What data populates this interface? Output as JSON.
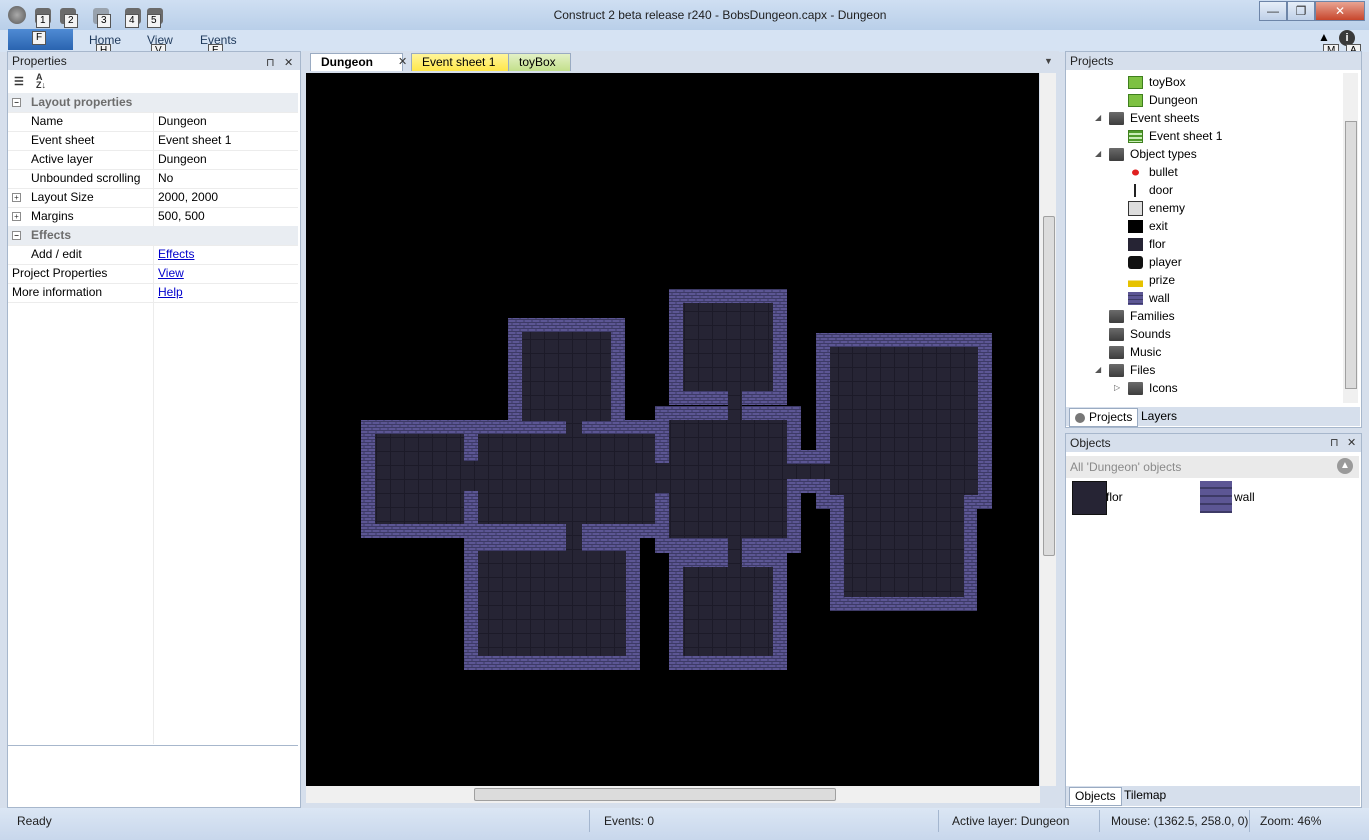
{
  "window": {
    "title": "Construct 2 beta release r240 - BobsDungeon.capx - Dungeon",
    "controls": [
      "—",
      "❐",
      "✕"
    ]
  },
  "qat": {
    "keytips": [
      "1",
      "2",
      "3",
      "4",
      "5"
    ]
  },
  "ribbon": {
    "file_keytip": "F",
    "tabs": [
      {
        "label": "Home",
        "keytip": "H"
      },
      {
        "label": "View",
        "keytip": "V"
      },
      {
        "label": "Events",
        "keytip": "E"
      }
    ],
    "right_keytips": [
      "M",
      "A"
    ]
  },
  "properties": {
    "title": "Properties",
    "pin": "⊓",
    "close": "✕",
    "rows": [
      {
        "type": "cat",
        "key": "Layout properties",
        "value": "",
        "expander": "−"
      },
      {
        "type": "prop",
        "key": "Name",
        "value": "Dungeon"
      },
      {
        "type": "prop",
        "key": "Event sheet",
        "value": "Event sheet 1"
      },
      {
        "type": "prop",
        "key": "Active layer",
        "value": "Dungeon"
      },
      {
        "type": "prop",
        "key": "Unbounded scrolling",
        "value": "No"
      },
      {
        "type": "prop",
        "key": "Layout Size",
        "value": "2000, 2000",
        "expander": "+"
      },
      {
        "type": "prop",
        "key": "Margins",
        "value": "500, 500",
        "expander": "+"
      },
      {
        "type": "cat",
        "key": "Effects",
        "value": "",
        "expander": "−"
      },
      {
        "type": "link",
        "key": "Add / edit",
        "value": "Effects"
      },
      {
        "type": "toplink",
        "key": "Project Properties",
        "value": "View"
      },
      {
        "type": "toplink",
        "key": "More information",
        "value": "Help"
      }
    ]
  },
  "doc_tabs": [
    {
      "label": "Dungeon",
      "close": "✕"
    },
    {
      "label": "Event sheet 1"
    },
    {
      "label": "toyBox"
    }
  ],
  "projects": {
    "title": "Projects",
    "items": [
      {
        "label": "toyBox",
        "icon": "layout-icon",
        "indent": 2
      },
      {
        "label": "Dungeon",
        "icon": "layout-icon",
        "indent": 2
      },
      {
        "label": "Event sheets",
        "icon": "folder-open-icon",
        "indent": 1,
        "toggle": "◢"
      },
      {
        "label": "Event sheet 1",
        "icon": "event-sheet-icon",
        "indent": 2
      },
      {
        "label": "Object types",
        "icon": "folder-open-icon",
        "indent": 1,
        "toggle": "◢"
      },
      {
        "label": "bullet",
        "icon": "bullet-icon",
        "indent": 2
      },
      {
        "label": "door",
        "icon": "door-icon",
        "indent": 2
      },
      {
        "label": "enemy",
        "icon": "enemy-icon",
        "indent": 2
      },
      {
        "label": "exit",
        "icon": "exit-icon",
        "indent": 2
      },
      {
        "label": "flor",
        "icon": "floor-icon",
        "indent": 2
      },
      {
        "label": "player",
        "icon": "player-icon",
        "indent": 2
      },
      {
        "label": "prize",
        "icon": "prize-icon",
        "indent": 2
      },
      {
        "label": "wall",
        "icon": "wall-icon",
        "indent": 2
      },
      {
        "label": "Families",
        "icon": "folder-icon",
        "indent": 1
      },
      {
        "label": "Sounds",
        "icon": "folder-icon",
        "indent": 1
      },
      {
        "label": "Music",
        "icon": "folder-icon",
        "indent": 1
      },
      {
        "label": "Files",
        "icon": "folder-open-icon",
        "indent": 1,
        "toggle": "◢"
      },
      {
        "label": "Icons",
        "icon": "folder-icon",
        "indent": 2,
        "toggle": "▷"
      }
    ],
    "bottom_tabs": [
      "Projects",
      "Layers"
    ]
  },
  "objects": {
    "title": "Objects",
    "filter_label": "All 'Dungeon' objects",
    "items": [
      {
        "label": "flor",
        "icon": "floor-icon"
      },
      {
        "label": "wall",
        "icon": "wall-icon"
      }
    ],
    "bottom_tabs": [
      "Objects",
      "Tilemap"
    ]
  },
  "status": {
    "ready": "Ready",
    "events": "Events: 0",
    "active_layer": "Active layer: Dungeon",
    "mouse": "Mouse: (1362.5, 258.0, 0)",
    "zoom": "Zoom: 46%"
  },
  "colors": {
    "canvas": "#000000",
    "wall": "#5c5694",
    "floor": "#262434",
    "accent": "#2a64b0"
  }
}
